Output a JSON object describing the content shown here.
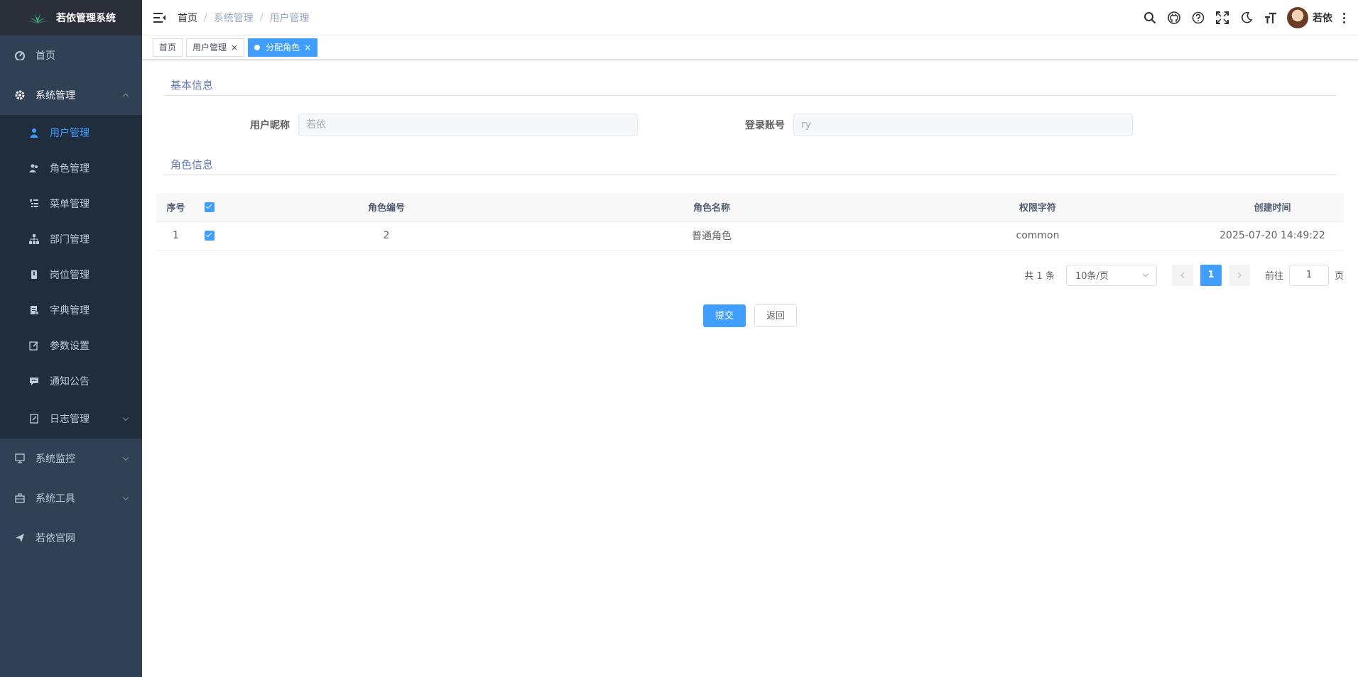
{
  "app": {
    "title": "若依管理系统"
  },
  "sidebar": {
    "items": [
      {
        "label": "首页",
        "icon": "dashboard-icon"
      },
      {
        "label": "系统管理",
        "icon": "gear-icon",
        "open": true,
        "children": [
          {
            "label": "用户管理",
            "icon": "user-icon",
            "active": true
          },
          {
            "label": "角色管理",
            "icon": "peoples-icon"
          },
          {
            "label": "菜单管理",
            "icon": "tree-table-icon"
          },
          {
            "label": "部门管理",
            "icon": "tree-icon"
          },
          {
            "label": "岗位管理",
            "icon": "post-icon"
          },
          {
            "label": "字典管理",
            "icon": "dict-icon"
          },
          {
            "label": "参数设置",
            "icon": "edit-icon"
          },
          {
            "label": "通知公告",
            "icon": "message-icon"
          },
          {
            "label": "日志管理",
            "icon": "log-icon",
            "has_children": true
          }
        ]
      },
      {
        "label": "系统监控",
        "icon": "monitor-icon",
        "has_children": true
      },
      {
        "label": "系统工具",
        "icon": "tool-icon",
        "has_children": true
      },
      {
        "label": "若依官网",
        "icon": "guide-icon"
      }
    ]
  },
  "navbar": {
    "breadcrumb": [
      "首页",
      "系统管理",
      "用户管理"
    ],
    "separator": "/",
    "username": "若依"
  },
  "tags": [
    {
      "label": "首页"
    },
    {
      "label": "用户管理",
      "closable": true
    },
    {
      "label": "分配角色",
      "closable": true,
      "active": true
    }
  ],
  "basic_info": {
    "title": "基本信息",
    "nickname_label": "用户昵称",
    "nickname_value": "若依",
    "account_label": "登录账号",
    "account_value": "ry"
  },
  "role_info": {
    "title": "角色信息",
    "columns": [
      "序号",
      "角色编号",
      "角色名称",
      "权限字符",
      "创建时间"
    ],
    "rows": [
      {
        "index": "1",
        "role_id": "2",
        "role_name": "普通角色",
        "role_key": "common",
        "create_time": "2025-07-20 14:49:22",
        "checked": true
      }
    ]
  },
  "pagination": {
    "total": "共 1 条",
    "page_size": "10条/页",
    "current_page": "1",
    "goto_label": "前往",
    "goto_value": "1",
    "page_suffix": "页"
  },
  "actions": {
    "submit": "提交",
    "back": "返回"
  },
  "colors": {
    "sidebar_bg": "#304156",
    "accent": "#409eff",
    "submenu_bg": "#1f2d3d"
  }
}
